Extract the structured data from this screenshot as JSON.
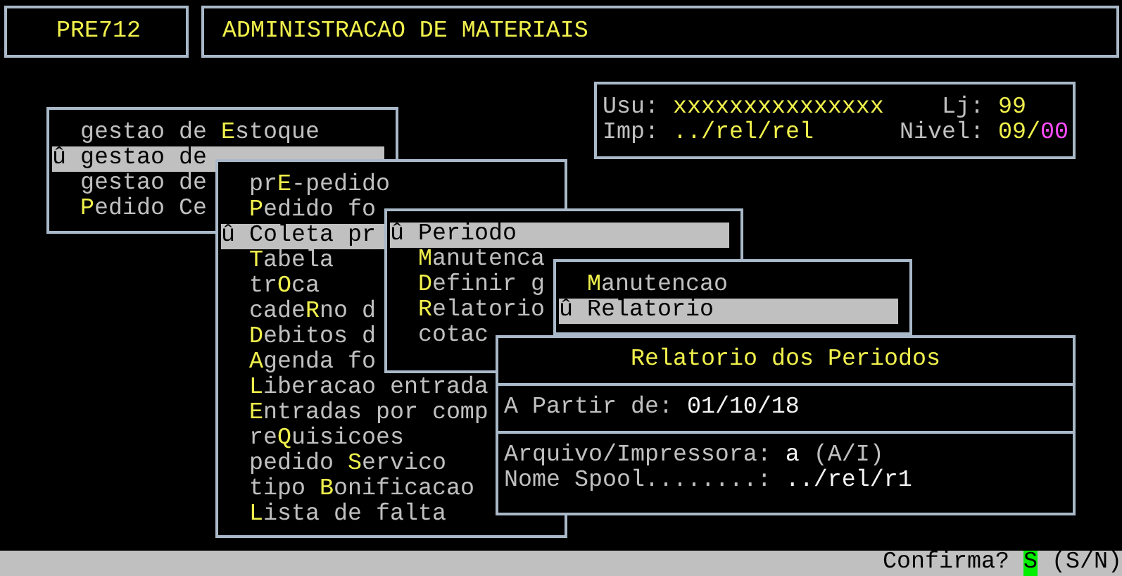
{
  "header": {
    "code": "PRE712",
    "title": "ADMINISTRACAO DE MATERIAIS"
  },
  "session_info": [
    {
      "label": "Usu:",
      "value": [
        {
          "text": "xxxxxxxxxxxxxxx",
          "color": "#f0f04c"
        }
      ]
    },
    {
      "label": "Lj:",
      "value": [
        {
          "text": "99",
          "color": "#f0f04c"
        }
      ]
    },
    {
      "label": "Imp:",
      "value": [
        {
          "text": "../rel/rel",
          "color": "#f0f04c"
        }
      ]
    },
    {
      "label": "Nivel:",
      "value": [
        {
          "text": "09/",
          "color": "#f0f04c"
        },
        {
          "text": "00",
          "color": "#ff4cff"
        }
      ]
    }
  ],
  "menus": [
    {
      "items": [
        {
          "before": "gestao de ",
          "key": "E",
          "after": "stoque",
          "selected": false
        },
        {
          "marker": "û",
          "before": "gestao de",
          "selected": true
        },
        {
          "before": "gestao de",
          "selected": false
        },
        {
          "key": "P",
          "after": "edido Ce",
          "selected": false
        }
      ]
    },
    {
      "items": [
        {
          "before": "pr",
          "key": "E",
          "after": "-pedido",
          "selected": false
        },
        {
          "key": "P",
          "after": "edido fo",
          "selected": false
        },
        {
          "marker": "û",
          "before": "Coleta pr",
          "selected": true
        },
        {
          "key": "T",
          "after": "abela",
          "selected": false
        },
        {
          "before": "tr",
          "key": "O",
          "after": "ca",
          "selected": false
        },
        {
          "before": "cade",
          "key": "R",
          "after": "no d",
          "selected": false
        },
        {
          "key": "D",
          "after": "ebitos d",
          "selected": false
        },
        {
          "key": "A",
          "after": "genda fo",
          "selected": false
        },
        {
          "key": "L",
          "after": "iberacao entrada",
          "selected": false
        },
        {
          "key": "E",
          "after": "ntradas por comp",
          "selected": false
        },
        {
          "before": "re",
          "key": "Q",
          "after": "uisicoes",
          "selected": false
        },
        {
          "before": "pedido ",
          "key": "S",
          "after": "ervico",
          "selected": false
        },
        {
          "before": "tipo ",
          "key": "B",
          "after": "onificacao",
          "selected": false
        },
        {
          "key": "L",
          "after": "ista de falta",
          "selected": false
        }
      ]
    },
    {
      "items": [
        {
          "marker": "û",
          "before": "Periodo",
          "selected": true
        },
        {
          "key": "M",
          "after": "anutenca",
          "selected": false
        },
        {
          "key": "D",
          "after": "efinir g",
          "selected": false
        },
        {
          "key": "R",
          "after": "elatorio",
          "selected": false
        },
        {
          "before": "cotac",
          "selected": false
        }
      ]
    },
    {
      "items": [
        {
          "key": "M",
          "after": "anutencao",
          "selected": false
        },
        {
          "marker": "û",
          "before": "Relatorio",
          "selected": true
        }
      ]
    }
  ],
  "dialog": {
    "title": "Relatorio dos Periodos",
    "sections": [
      [
        {
          "label": "A Partir de:",
          "value": "01/10/18"
        }
      ],
      [
        {
          "label": "Arquivo/Impressora:",
          "value": "a",
          "hint": "(A/I)"
        },
        {
          "label": "Nome Spool........:",
          "value": "../rel/r1"
        }
      ]
    ]
  },
  "status_bar": {
    "prompt": "Confirma?",
    "answer": "S",
    "options": "(S/N)"
  }
}
